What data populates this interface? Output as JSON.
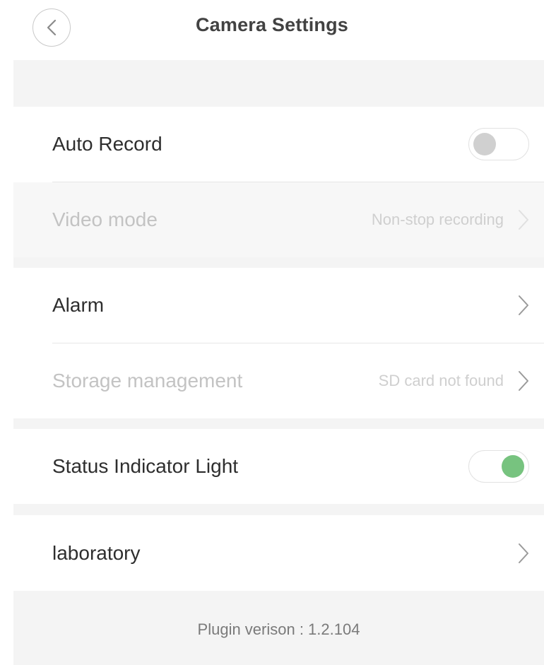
{
  "header": {
    "title": "Camera Settings",
    "back_icon": "chevron-left-icon"
  },
  "settings": {
    "auto_record": {
      "label": "Auto Record",
      "toggle": "off"
    },
    "video_mode": {
      "label": "Video mode",
      "value": "Non-stop recording",
      "enabled": false
    },
    "alarm": {
      "label": "Alarm"
    },
    "storage": {
      "label": "Storage management",
      "value": "SD card not found",
      "enabled": false
    },
    "status_light": {
      "label": "Status Indicator Light",
      "toggle": "on"
    },
    "laboratory": {
      "label": "laboratory"
    }
  },
  "footer": {
    "plugin_version": "Plugin verison : 1.2.104"
  },
  "colors": {
    "toggle_on": "#77c37f",
    "toggle_off": "#d0d0d0",
    "section_gap": "#f4f4f4"
  }
}
